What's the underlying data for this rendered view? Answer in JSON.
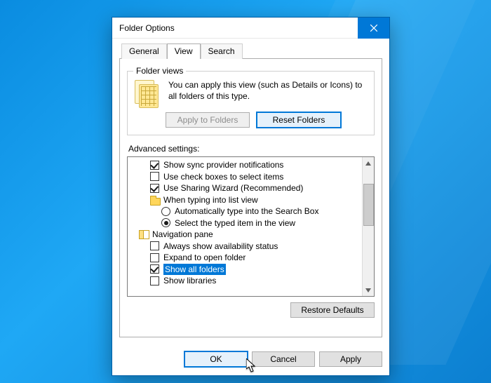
{
  "window": {
    "title": "Folder Options"
  },
  "tabs": {
    "general": "General",
    "view": "View",
    "search": "Search"
  },
  "folder_views": {
    "legend": "Folder views",
    "text": "You can apply this view (such as Details or Icons) to all folders of this type.",
    "apply_btn": "Apply to Folders",
    "reset_btn": "Reset Folders"
  },
  "advanced": {
    "label": "Advanced settings:",
    "items": [
      {
        "kind": "checkbox",
        "checked": true,
        "label": "Show sync provider notifications",
        "indent": 2
      },
      {
        "kind": "checkbox",
        "checked": false,
        "label": "Use check boxes to select items",
        "indent": 2
      },
      {
        "kind": "checkbox",
        "checked": true,
        "label": "Use Sharing Wizard (Recommended)",
        "indent": 2
      },
      {
        "kind": "folder",
        "label": "When typing into list view",
        "indent": 2
      },
      {
        "kind": "radio",
        "checked": false,
        "label": "Automatically type into the Search Box",
        "indent": 3
      },
      {
        "kind": "radio",
        "checked": true,
        "label": "Select the typed item in the view",
        "indent": 3
      },
      {
        "kind": "navpane",
        "label": "Navigation pane",
        "indent": 1
      },
      {
        "kind": "checkbox",
        "checked": false,
        "label": "Always show availability status",
        "indent": 2
      },
      {
        "kind": "checkbox",
        "checked": false,
        "label": "Expand to open folder",
        "indent": 2
      },
      {
        "kind": "checkbox",
        "checked": true,
        "label": "Show all folders",
        "highlight": true,
        "indent": 2
      },
      {
        "kind": "checkbox",
        "checked": false,
        "label": "Show libraries",
        "indent": 2
      }
    ],
    "restore_btn": "Restore Defaults"
  },
  "footer": {
    "ok": "OK",
    "cancel": "Cancel",
    "apply": "Apply"
  }
}
